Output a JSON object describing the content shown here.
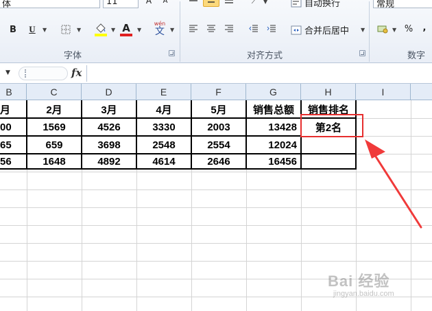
{
  "ribbon": {
    "font_name": "体",
    "font_size": "11",
    "wrap_text_label": "自动换行",
    "merge_center_label": "合并后居中",
    "number_format": "常规",
    "font_group_label": "字体",
    "alignment_group_label": "对齐方式",
    "number_group_label": "数字",
    "bold_label": "B",
    "italic_label": "I",
    "underline_label": "U",
    "font_color_label": "A",
    "phonetic_label": "wén",
    "phonetic_glyph": "文",
    "percent_label": "%",
    "comma_label": ",",
    "font_color": "#e02020",
    "fill_color": "#ffff00"
  },
  "formula_bar": {
    "fx_label": "fx",
    "value": ""
  },
  "grid": {
    "column_headers": [
      "B",
      "C",
      "D",
      "E",
      "F",
      "G",
      "H",
      "I"
    ],
    "rows": [
      [
        "月",
        "2月",
        "3月",
        "4月",
        "5月",
        "销售总额",
        "销售排名"
      ],
      [
        "00",
        "1569",
        "4526",
        "3330",
        "2003",
        "13428",
        "第2名"
      ],
      [
        "65",
        "659",
        "3698",
        "2548",
        "2554",
        "12024",
        ""
      ],
      [
        "56",
        "1648",
        "4892",
        "4614",
        "2646",
        "16456",
        ""
      ]
    ],
    "highlight_color": "#e62e2e"
  },
  "watermark": {
    "main": "Bai 经验",
    "sub": "jingyan.baidu.com"
  }
}
